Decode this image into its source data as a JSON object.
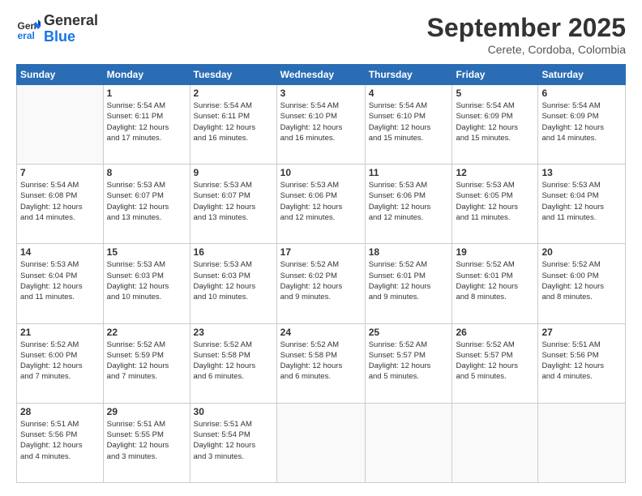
{
  "logo": {
    "line1": "General",
    "line2": "Blue"
  },
  "title": "September 2025",
  "subtitle": "Cerete, Cordoba, Colombia",
  "days_header": [
    "Sunday",
    "Monday",
    "Tuesday",
    "Wednesday",
    "Thursday",
    "Friday",
    "Saturday"
  ],
  "weeks": [
    [
      {
        "num": "",
        "info": ""
      },
      {
        "num": "1",
        "info": "Sunrise: 5:54 AM\nSunset: 6:11 PM\nDaylight: 12 hours\nand 17 minutes."
      },
      {
        "num": "2",
        "info": "Sunrise: 5:54 AM\nSunset: 6:11 PM\nDaylight: 12 hours\nand 16 minutes."
      },
      {
        "num": "3",
        "info": "Sunrise: 5:54 AM\nSunset: 6:10 PM\nDaylight: 12 hours\nand 16 minutes."
      },
      {
        "num": "4",
        "info": "Sunrise: 5:54 AM\nSunset: 6:10 PM\nDaylight: 12 hours\nand 15 minutes."
      },
      {
        "num": "5",
        "info": "Sunrise: 5:54 AM\nSunset: 6:09 PM\nDaylight: 12 hours\nand 15 minutes."
      },
      {
        "num": "6",
        "info": "Sunrise: 5:54 AM\nSunset: 6:09 PM\nDaylight: 12 hours\nand 14 minutes."
      }
    ],
    [
      {
        "num": "7",
        "info": "Sunrise: 5:54 AM\nSunset: 6:08 PM\nDaylight: 12 hours\nand 14 minutes."
      },
      {
        "num": "8",
        "info": "Sunrise: 5:53 AM\nSunset: 6:07 PM\nDaylight: 12 hours\nand 13 minutes."
      },
      {
        "num": "9",
        "info": "Sunrise: 5:53 AM\nSunset: 6:07 PM\nDaylight: 12 hours\nand 13 minutes."
      },
      {
        "num": "10",
        "info": "Sunrise: 5:53 AM\nSunset: 6:06 PM\nDaylight: 12 hours\nand 12 minutes."
      },
      {
        "num": "11",
        "info": "Sunrise: 5:53 AM\nSunset: 6:06 PM\nDaylight: 12 hours\nand 12 minutes."
      },
      {
        "num": "12",
        "info": "Sunrise: 5:53 AM\nSunset: 6:05 PM\nDaylight: 12 hours\nand 11 minutes."
      },
      {
        "num": "13",
        "info": "Sunrise: 5:53 AM\nSunset: 6:04 PM\nDaylight: 12 hours\nand 11 minutes."
      }
    ],
    [
      {
        "num": "14",
        "info": "Sunrise: 5:53 AM\nSunset: 6:04 PM\nDaylight: 12 hours\nand 11 minutes."
      },
      {
        "num": "15",
        "info": "Sunrise: 5:53 AM\nSunset: 6:03 PM\nDaylight: 12 hours\nand 10 minutes."
      },
      {
        "num": "16",
        "info": "Sunrise: 5:53 AM\nSunset: 6:03 PM\nDaylight: 12 hours\nand 10 minutes."
      },
      {
        "num": "17",
        "info": "Sunrise: 5:52 AM\nSunset: 6:02 PM\nDaylight: 12 hours\nand 9 minutes."
      },
      {
        "num": "18",
        "info": "Sunrise: 5:52 AM\nSunset: 6:01 PM\nDaylight: 12 hours\nand 9 minutes."
      },
      {
        "num": "19",
        "info": "Sunrise: 5:52 AM\nSunset: 6:01 PM\nDaylight: 12 hours\nand 8 minutes."
      },
      {
        "num": "20",
        "info": "Sunrise: 5:52 AM\nSunset: 6:00 PM\nDaylight: 12 hours\nand 8 minutes."
      }
    ],
    [
      {
        "num": "21",
        "info": "Sunrise: 5:52 AM\nSunset: 6:00 PM\nDaylight: 12 hours\nand 7 minutes."
      },
      {
        "num": "22",
        "info": "Sunrise: 5:52 AM\nSunset: 5:59 PM\nDaylight: 12 hours\nand 7 minutes."
      },
      {
        "num": "23",
        "info": "Sunrise: 5:52 AM\nSunset: 5:58 PM\nDaylight: 12 hours\nand 6 minutes."
      },
      {
        "num": "24",
        "info": "Sunrise: 5:52 AM\nSunset: 5:58 PM\nDaylight: 12 hours\nand 6 minutes."
      },
      {
        "num": "25",
        "info": "Sunrise: 5:52 AM\nSunset: 5:57 PM\nDaylight: 12 hours\nand 5 minutes."
      },
      {
        "num": "26",
        "info": "Sunrise: 5:52 AM\nSunset: 5:57 PM\nDaylight: 12 hours\nand 5 minutes."
      },
      {
        "num": "27",
        "info": "Sunrise: 5:51 AM\nSunset: 5:56 PM\nDaylight: 12 hours\nand 4 minutes."
      }
    ],
    [
      {
        "num": "28",
        "info": "Sunrise: 5:51 AM\nSunset: 5:56 PM\nDaylight: 12 hours\nand 4 minutes."
      },
      {
        "num": "29",
        "info": "Sunrise: 5:51 AM\nSunset: 5:55 PM\nDaylight: 12 hours\nand 3 minutes."
      },
      {
        "num": "30",
        "info": "Sunrise: 5:51 AM\nSunset: 5:54 PM\nDaylight: 12 hours\nand 3 minutes."
      },
      {
        "num": "",
        "info": ""
      },
      {
        "num": "",
        "info": ""
      },
      {
        "num": "",
        "info": ""
      },
      {
        "num": "",
        "info": ""
      }
    ]
  ]
}
